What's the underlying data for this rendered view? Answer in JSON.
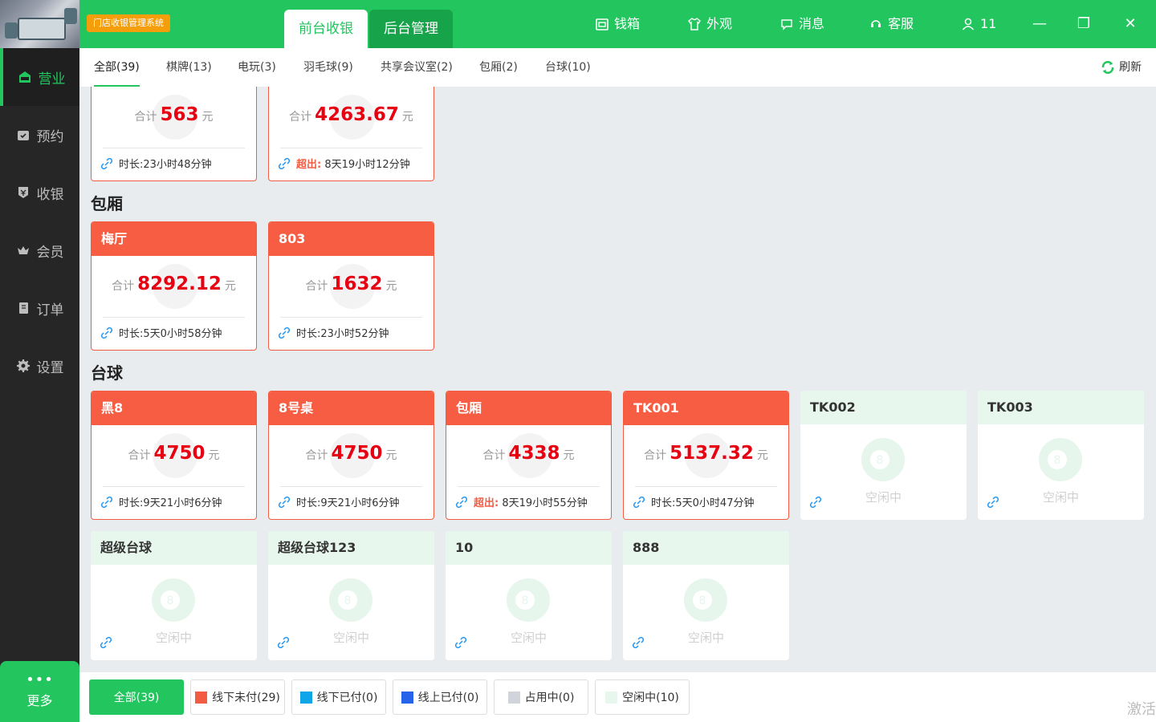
{
  "header": {
    "system_name": "门店收银管理系统",
    "tabs": [
      {
        "label": "前台收银",
        "active": true
      },
      {
        "label": "后台管理",
        "active": false
      }
    ],
    "actions": [
      {
        "label": "钱箱",
        "icon": "cashbox-icon"
      },
      {
        "label": "外观",
        "icon": "shirt-icon"
      },
      {
        "label": "消息",
        "icon": "message-icon"
      },
      {
        "label": "客服",
        "icon": "support-icon"
      },
      {
        "label": "11",
        "icon": "user-icon"
      }
    ],
    "window_controls": {
      "minimize": "—",
      "restore": "❐",
      "close": "✕"
    }
  },
  "sidebar": {
    "items": [
      {
        "label": "营业",
        "icon": "open-icon",
        "active": true
      },
      {
        "label": "预约",
        "icon": "calendar-icon"
      },
      {
        "label": "收银",
        "icon": "cashier-icon"
      },
      {
        "label": "会员",
        "icon": "crown-icon"
      },
      {
        "label": "订单",
        "icon": "order-icon"
      },
      {
        "label": "设置",
        "icon": "gear-icon"
      }
    ],
    "more": {
      "dots": "•••",
      "label": "更多"
    }
  },
  "categories": [
    {
      "label": "全部(39)",
      "active": true
    },
    {
      "label": "棋牌(13)"
    },
    {
      "label": "电玩(3)"
    },
    {
      "label": "羽毛球(9)"
    },
    {
      "label": "共享会议室(2)"
    },
    {
      "label": "包厢(2)"
    },
    {
      "label": "台球(10)"
    }
  ],
  "refresh_label": "刷新",
  "total_prefix": "合计",
  "currency_unit": "元",
  "idle_label": "空闲中",
  "top_cards": [
    {
      "amount": "563",
      "duration": "时长:23小时48分钟"
    },
    {
      "amount": "4263.67",
      "overtime_label": "超出:",
      "duration": "8天19小时12分钟"
    }
  ],
  "sections": {
    "baoxiang": {
      "title": "包厢"
    },
    "taiqiu": {
      "title": "台球"
    }
  },
  "baoxiang_cards": [
    {
      "name": "梅厅",
      "amount": "8292.12",
      "duration": "时长:5天0小时58分钟"
    },
    {
      "name": "803",
      "amount": "1632",
      "duration": "时长:23小时52分钟"
    }
  ],
  "taiqiu_cards": [
    {
      "name": "黑8",
      "amount": "4750",
      "duration": "时长:9天21小时6分钟"
    },
    {
      "name": "8号桌",
      "amount": "4750",
      "duration": "时长:9天21小时6分钟"
    },
    {
      "name": "包厢",
      "amount": "4338",
      "overtime_label": "超出:",
      "duration": "8天19小时55分钟"
    },
    {
      "name": "TK001",
      "amount": "5137.32",
      "duration": "时长:5天0小时47分钟"
    },
    {
      "name": "TK002",
      "idle": true
    },
    {
      "name": "TK003",
      "idle": true
    },
    {
      "name": "超级台球",
      "idle": true
    },
    {
      "name": "超级台球123",
      "idle": true
    },
    {
      "name": "10",
      "idle": true
    },
    {
      "name": "888",
      "idle": true
    }
  ],
  "filters": [
    {
      "label": "全部(39)",
      "active": true
    },
    {
      "label": "线下未付(29)",
      "color": "#f25c43"
    },
    {
      "label": "线下已付(0)",
      "color": "#0ea5e9"
    },
    {
      "label": "线上已付(0)",
      "color": "#2563eb"
    },
    {
      "label": "占用中(0)",
      "color": "#d1d5db"
    },
    {
      "label": "空闲中(10)",
      "color": "#e8f7ee"
    }
  ],
  "watermark": "激活"
}
